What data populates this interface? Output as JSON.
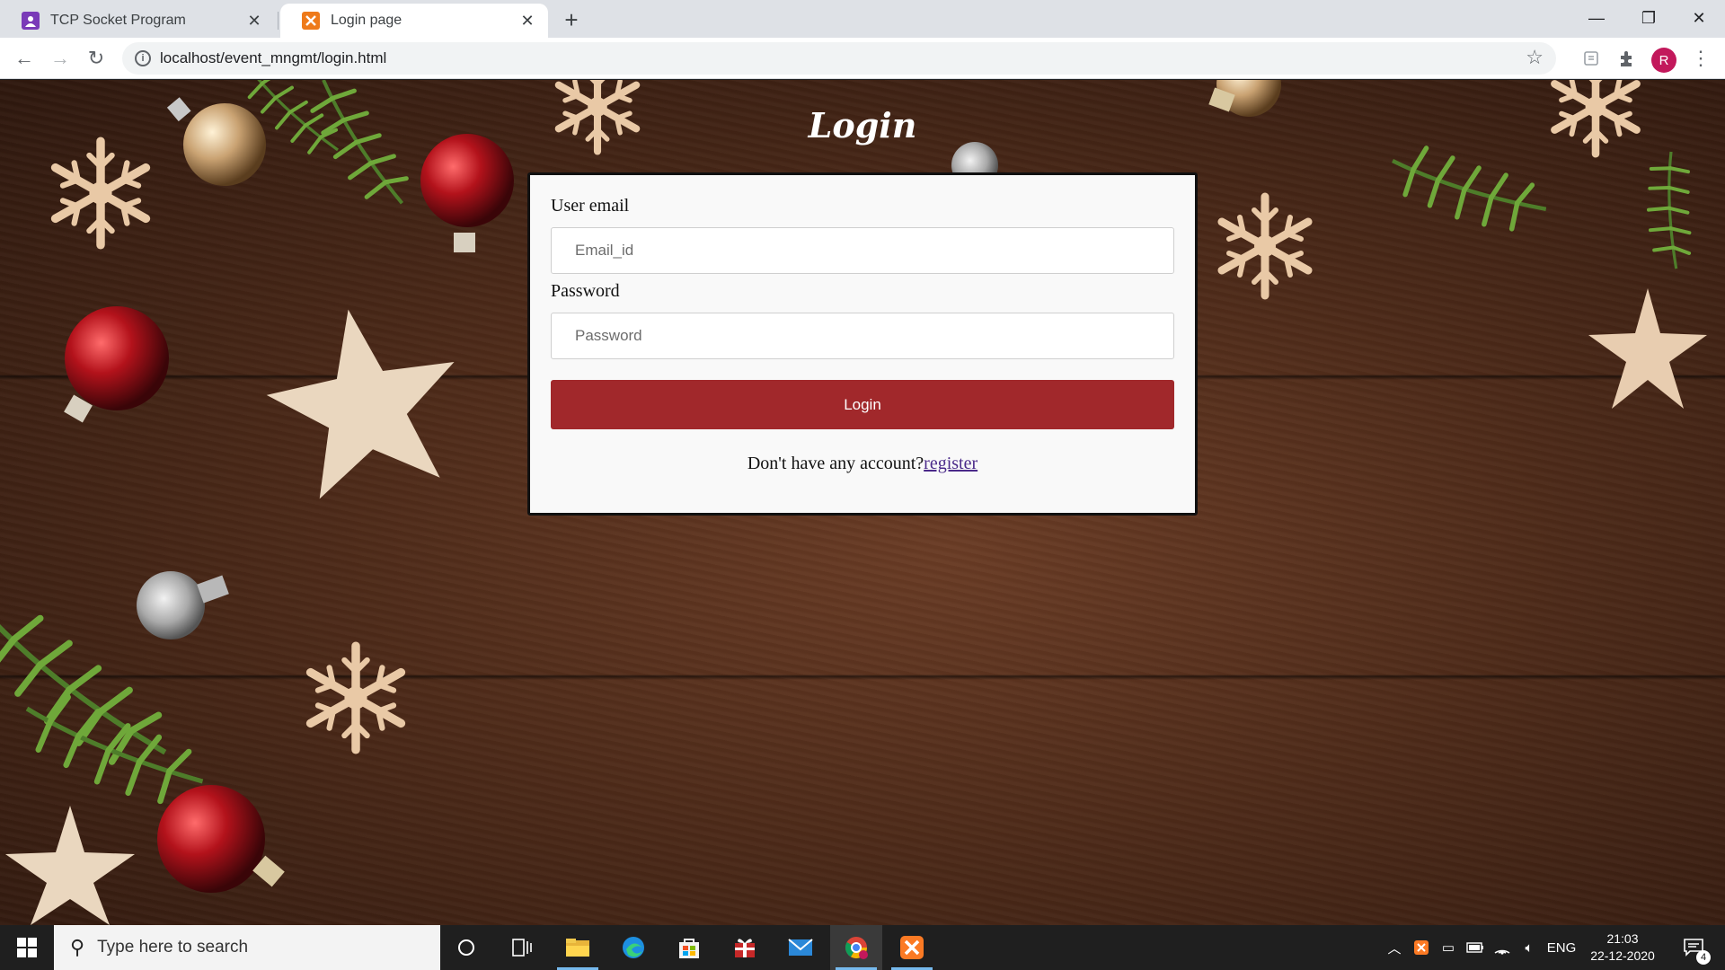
{
  "browser": {
    "tabs": [
      {
        "label": "TCP Socket Program",
        "icon": "contacts-icon"
      },
      {
        "label": "Login page",
        "icon": "xampp-icon"
      }
    ],
    "url": "localhost/event_mngmt/login.html",
    "profile_initial": "R"
  },
  "page": {
    "title": "Login",
    "form": {
      "email_label": "User email",
      "email_placeholder": "Email_id",
      "password_label": "Password",
      "password_placeholder": "Password",
      "login_button": "Login",
      "register_prompt": "Don't have any account?",
      "register_link": "register"
    },
    "colors": {
      "button": "#a1282b",
      "card": "#f9f9f9"
    }
  },
  "taskbar": {
    "search_placeholder": "Type here to search",
    "language": "ENG",
    "time": "21:03",
    "date": "22-12-2020",
    "notification_count": "4"
  }
}
